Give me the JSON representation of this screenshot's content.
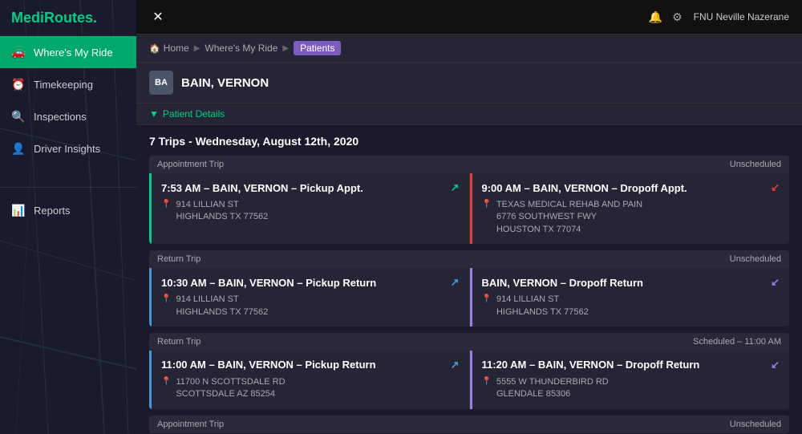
{
  "app": {
    "logo_prefix": "MediR",
    "logo_highlight": "outes",
    "logo_dot": "."
  },
  "sidebar": {
    "nav_items": [
      {
        "id": "wheres-my-ride",
        "label": "Where's My Ride",
        "icon": "🚗",
        "active": true
      },
      {
        "id": "timekeeping",
        "label": "Timekeeping",
        "icon": "⏰",
        "active": false
      },
      {
        "id": "inspections",
        "label": "Inspections",
        "icon": "🔍",
        "active": false
      },
      {
        "id": "driver-insights",
        "label": "Driver Insights",
        "icon": "👤",
        "active": false
      }
    ],
    "reports_item": {
      "id": "reports",
      "label": "Reports",
      "icon": "📊"
    }
  },
  "topbar": {
    "close_label": "✕",
    "icons": [
      "🔔",
      "⚙"
    ],
    "user_name": "FNU Neville Nazerane"
  },
  "breadcrumb": {
    "home_label": "Home",
    "items": [
      {
        "label": "Where's My Ride",
        "active": false
      },
      {
        "label": "Patients",
        "active": true
      }
    ]
  },
  "patient": {
    "initials": "BA",
    "name": "BAIN, VERNON",
    "details_label": "Patient Details"
  },
  "trips": {
    "header": "7 Trips - Wednesday, August 12th, 2020",
    "cards": [
      {
        "type_label": "Appointment Trip",
        "status": "Unscheduled",
        "left": {
          "title": "7:53 AM – BAIN, VERNON – Pickup Appt.",
          "arrow_dir": "↗",
          "arrow_color": "green",
          "border": "green-border",
          "location_line1": "914 LILLIAN ST",
          "location_line2": "HIGHLANDS TX 77562"
        },
        "right": {
          "title": "9:00 AM – BAIN, VERNON – Dropoff Appt.",
          "arrow_dir": "↗",
          "arrow_color": "red",
          "border": "red-border",
          "location_line1": "TEXAS MEDICAL REHAB AND PAIN",
          "location_line2": "6776 SOUTHWEST FWY",
          "location_line3": "HOUSTON TX 77074"
        }
      },
      {
        "type_label": "Return Trip",
        "status": "Unscheduled",
        "left": {
          "title": "10:30 AM – BAIN, VERNON – Pickup Return",
          "arrow_dir": "↗",
          "arrow_color": "blue",
          "border": "blue-border",
          "location_line1": "914 LILLIAN ST",
          "location_line2": "HIGHLANDS TX 77562"
        },
        "right": {
          "title": "BAIN, VERNON – Dropoff Return",
          "arrow_dir": "↗",
          "arrow_color": "purple",
          "border": "purple-border",
          "location_line1": "914 LILLIAN ST",
          "location_line2": "HIGHLANDS TX 77562"
        }
      },
      {
        "type_label": "Return Trip",
        "status": "Scheduled – 11:00 AM",
        "left": {
          "title": "11:00 AM – BAIN, VERNON – Pickup Return",
          "arrow_dir": "↗",
          "arrow_color": "blue",
          "border": "blue-border",
          "location_line1": "11700 N SCOTTSDALE RD",
          "location_line2": "SCOTTSDALE AZ 85254"
        },
        "right": {
          "title": "11:20 AM – BAIN, VERNON – Dropoff Return",
          "arrow_dir": "↗",
          "arrow_color": "purple",
          "border": "purple-border",
          "location_line1": "5555 W THUNDERBIRD RD",
          "location_line2": "GLENDALE 85306"
        }
      },
      {
        "type_label": "Appointment Trip",
        "status": "Unscheduled",
        "left": {
          "title": "",
          "arrow_dir": "",
          "arrow_color": "green",
          "border": "green-border",
          "location_line1": "",
          "location_line2": ""
        },
        "right": {
          "title": "",
          "arrow_dir": "",
          "arrow_color": "red",
          "border": "red-border",
          "location_line1": "",
          "location_line2": ""
        }
      }
    ]
  }
}
